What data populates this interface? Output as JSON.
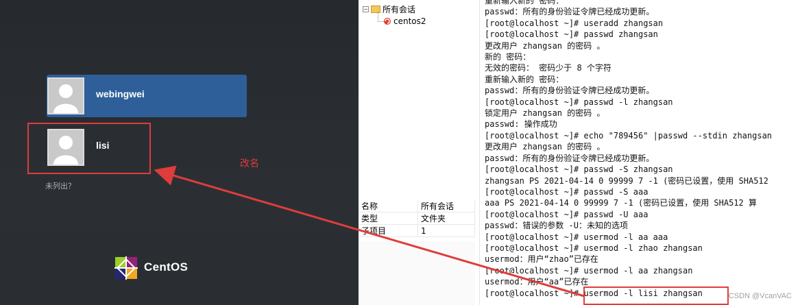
{
  "login": {
    "users": [
      {
        "name": "webingwei",
        "selected": true
      },
      {
        "name": "lisi",
        "selected": false
      }
    ],
    "not_listed_link": "未列出？",
    "logo_text": "CentOS",
    "annotation_note": "改名",
    "annotation_color": "#e03c3c"
  },
  "sessions": {
    "root_label": "所有会话",
    "child_label": "centos2",
    "properties": [
      {
        "key": "名称",
        "value": "所有会话"
      },
      {
        "key": "类型",
        "value": "文件夹"
      },
      {
        "key": "子项目",
        "value": "1"
      }
    ]
  },
  "terminal": {
    "lines": [
      "重新输入新的 密码：",
      "passwd：所有的身份验证令牌已经成功更新。",
      "[root@localhost ~]# useradd zhangsan",
      "[root@localhost ~]# passwd zhangsan",
      "更改用户 zhangsan 的密码 。",
      "新的 密码：",
      "无效的密码： 密码少于 8 个字符",
      "重新输入新的 密码：",
      "passwd：所有的身份验证令牌已经成功更新。",
      "[root@localhost ~]# passwd -l zhangsan",
      "锁定用户 zhangsan 的密码 。",
      "passwd: 操作成功",
      "[root@localhost ~]# echo \"789456\" |passwd --stdin zhangsan",
      "更改用户 zhangsan 的密码 。",
      "passwd：所有的身份验证令牌已经成功更新。",
      "[root@localhost ~]# passwd -S zhangsan",
      "zhangsan PS 2021-04-14 0 99999 7 -1 (密码已设置，使用 SHA512",
      "[root@localhost ~]# passwd -S aaa",
      "aaa PS 2021-04-14 0 99999 7 -1 (密码已设置，使用 SHA512 算",
      "[root@localhost ~]# passwd -U aaa",
      "passwd：错误的参数 -U：未知的选项",
      "[root@localhost ~]# usermod -l aa aaa",
      "[root@localhost ~]# usermod -l zhao zhangsan",
      "usermod：用户“zhao”已存在",
      "[root@localhost ~]# usermod -l aa zhangsan",
      "usermod：用户“aa”已存在",
      "[root@localhost ~]# usermod -l lisi zhangsan"
    ],
    "watermark": "CSDN @VcanVAC"
  }
}
